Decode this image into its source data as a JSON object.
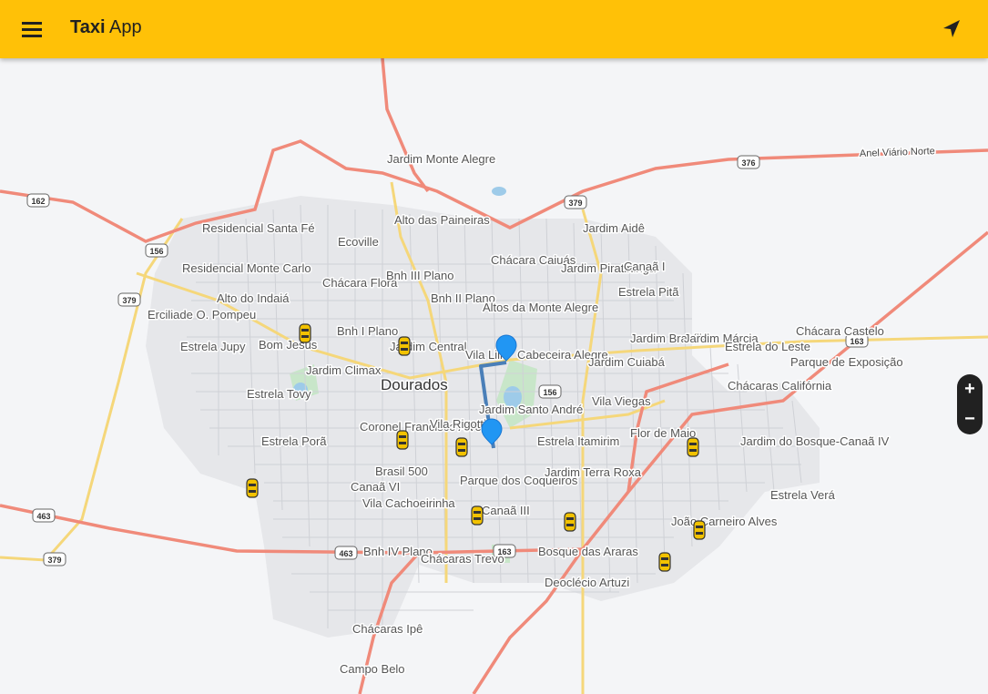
{
  "app": {
    "title_bold": "Taxi",
    "title_light": "App"
  },
  "icons": {
    "menu": "menu-icon",
    "locate": "navigation-arrow-icon",
    "taxi": "taxi-icon",
    "pin": "map-pin-icon"
  },
  "colors": {
    "appbar": "#ffc107",
    "route": "#4a7fb8",
    "pin": "#2196f3",
    "road_primary": "#f08a7a",
    "road_secondary": "#f5d77a"
  },
  "zoom": {
    "in_label": "+",
    "out_label": "−"
  },
  "map": {
    "city": "Dourados",
    "roads": {
      "anel": "Anel Viário Norte",
      "shields": [
        "162",
        "156",
        "379",
        "376",
        "379",
        "163",
        "156",
        "463",
        "379",
        "463",
        "163"
      ]
    },
    "places": [
      "Jardim Monte Alegre",
      "Alto das Paineiras",
      "Ecoville",
      "Residencial Santa Fé",
      "Residencial Monte Carlo",
      "Alto do Indaiá",
      "Erciliade O. Pompeu",
      "Estrela Jupy",
      "Bom Jesus",
      "Chácara Flora",
      "Bnh III Plano",
      "Bnh II Plano",
      "Bnh I Plano",
      "Chácara Caiuás",
      "Jardim Piratininga",
      "Jardim Aidê",
      "Canaã I",
      "Estrela Pitã",
      "Altos da Monte Alegre",
      "Jardim Central",
      "Jardim Climax",
      "Vila Lili",
      "Cabeceira Alegre",
      "Jardim Cuiabá",
      "Jardim Brasília",
      "Jardim Márcia",
      "Estrela do Leste",
      "Chácara Castelo",
      "Parque de Exposição",
      "Chácaras Califórnia",
      "Estrela Tovy",
      "Vila Viegas",
      "Jardim Santo André",
      "Coronel Francisco Alves",
      "Vila Rigotti",
      "Estrela Itamirim",
      "Flor de Maio",
      "Jardim do Bosque-Canaã IV",
      "Estrela Porã",
      "Brasil 500",
      "Canaã VI",
      "Parque dos Coqueiros",
      "Jardim Terra Roxa",
      "Estrela Verá",
      "Vila Cachoeirinha",
      "Canaã III",
      "João Carneiro Alves",
      "Bnh IV Plano",
      "Chácaras Trevo",
      "Bosque das Araras",
      "Deoclécio Artuzi",
      "Chácaras Ipê",
      "Campo Belo"
    ]
  }
}
